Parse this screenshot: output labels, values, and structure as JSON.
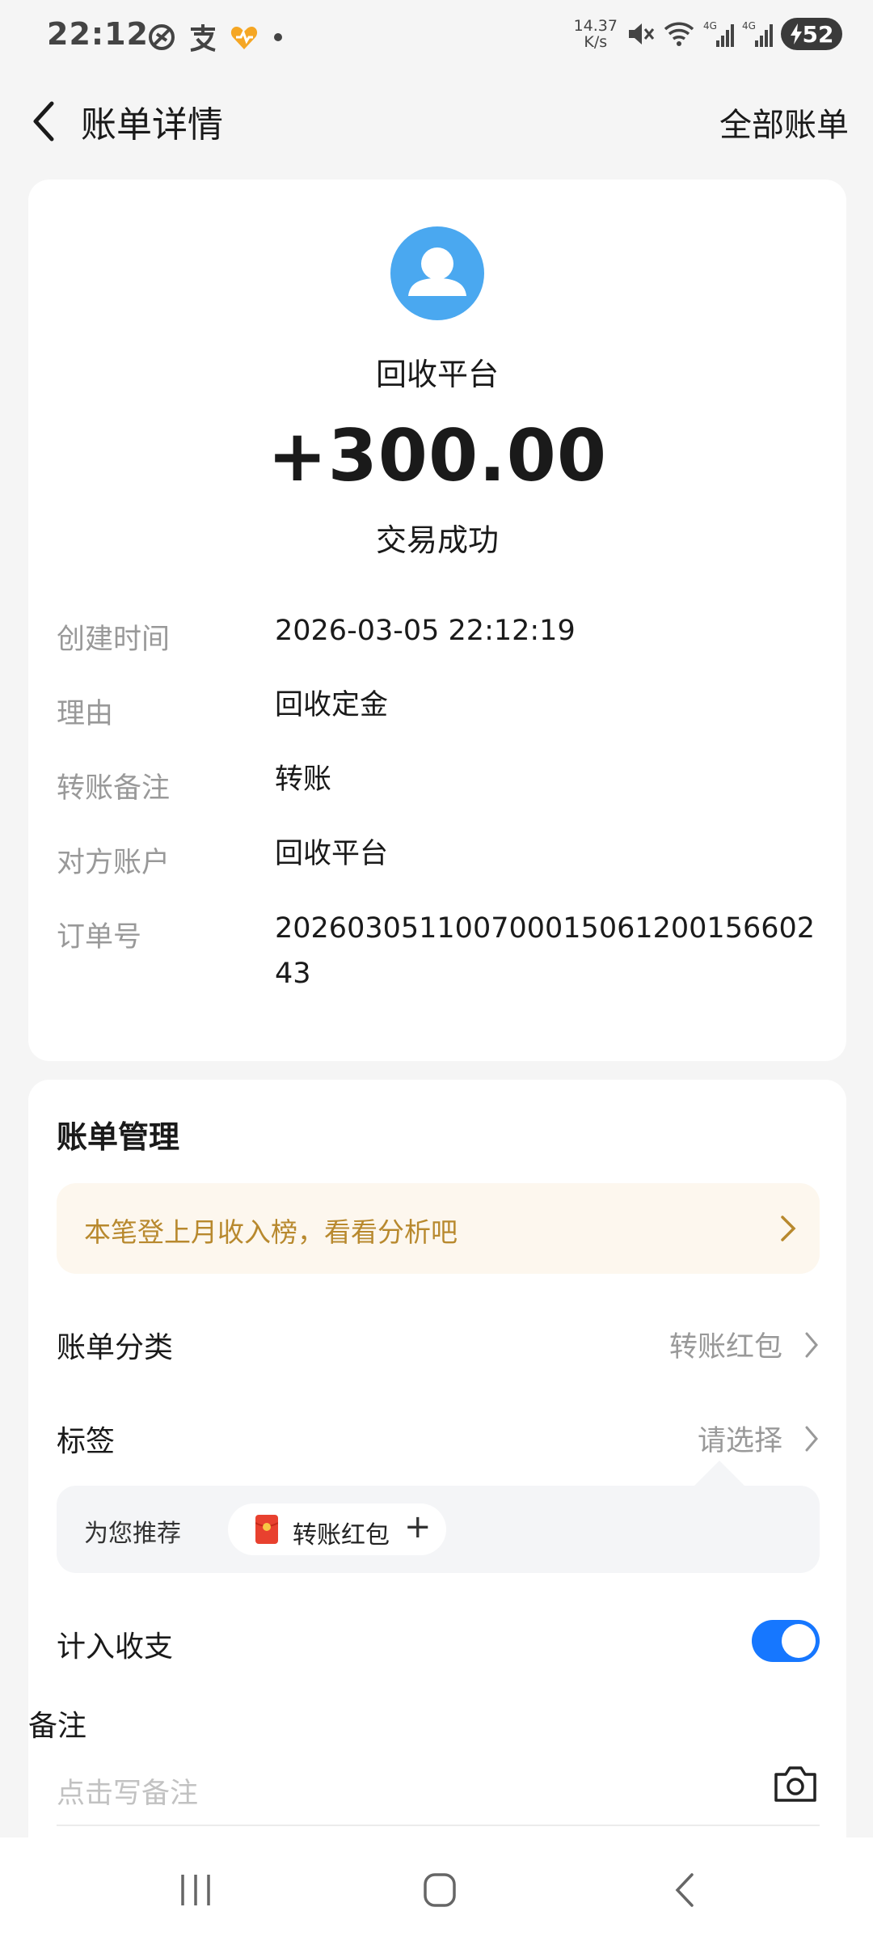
{
  "status_bar": {
    "time": "22:12",
    "net_speed_value": "14.37",
    "net_speed_unit": "K/s",
    "battery": "52",
    "icons": [
      "no-disturb-icon",
      "alipay-icon",
      "health-heart-icon",
      "dot-icon",
      "mute-icon",
      "wifi-icon",
      "signal-4g-icon",
      "signal-4g-icon",
      "battery-charging-icon"
    ]
  },
  "header": {
    "title": "账单详情",
    "right_link": "全部账单"
  },
  "summary": {
    "party_name": "回收平台",
    "amount": "+300.00",
    "status": "交易成功"
  },
  "details": [
    {
      "label": "创建时间",
      "value": "2026-03-05 22:12:19"
    },
    {
      "label": "理由",
      "value": "回收定金"
    },
    {
      "label": "转账备注",
      "value": "转账"
    },
    {
      "label": "对方账户",
      "value": "回收平台"
    },
    {
      "label": "订单号",
      "value": "20260305110070001506120015660243"
    }
  ],
  "management": {
    "title": "账单管理",
    "promo_text": "本笔登上月收入榜，看看分析吧",
    "category_label": "账单分类",
    "category_value": "转账红包",
    "tag_label": "标签",
    "tag_value": "请选择",
    "recommend_label": "为您推荐",
    "recommend_chip": "转账红包",
    "recommend_plus": "+",
    "include_label": "计入收支",
    "include_on": true,
    "remark_label": "备注",
    "remark_placeholder": "点击写备注",
    "remark_value": ""
  },
  "colors": {
    "accent": "#1677ff",
    "avatar_bg": "#4aa8f0",
    "promo_text": "#b8892e",
    "promo_bg": "#fdf7ee"
  }
}
